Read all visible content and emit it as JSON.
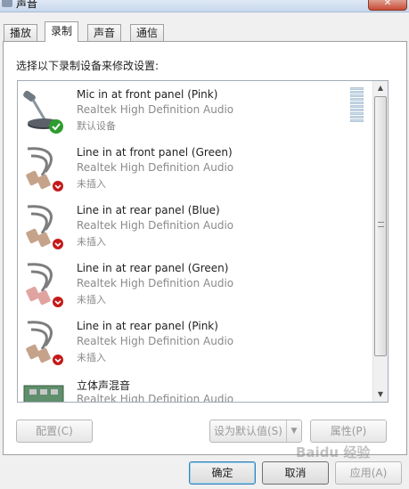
{
  "window": {
    "title": "声音"
  },
  "tabs": [
    {
      "label": "播放",
      "active": false
    },
    {
      "label": "录制",
      "active": true
    },
    {
      "label": "声音",
      "active": false
    },
    {
      "label": "通信",
      "active": false
    }
  ],
  "instruction": "选择以下录制设备来修改设置:",
  "devices": [
    {
      "name": "Mic in at front panel (Pink)",
      "driver": "Realtek High Definition Audio",
      "status": "默认设备",
      "icon": "microphone-icon",
      "badge": "default-check-icon"
    },
    {
      "name": "Line in at front panel (Green)",
      "driver": "Realtek High Definition Audio",
      "status": "未插入",
      "icon": "rca-cable-icon",
      "badge": "unplugged-icon"
    },
    {
      "name": "Line in at rear panel (Blue)",
      "driver": "Realtek High Definition Audio",
      "status": "未插入",
      "icon": "rca-cable-icon",
      "badge": "unplugged-icon"
    },
    {
      "name": "Line in at rear panel (Green)",
      "driver": "Realtek High Definition Audio",
      "status": "未插入",
      "icon": "rca-cable-icon",
      "badge": "unplugged-icon"
    },
    {
      "name": "Line in at rear panel (Pink)",
      "driver": "Realtek High Definition Audio",
      "status": "未插入",
      "icon": "rca-cable-icon",
      "badge": "unplugged-icon"
    },
    {
      "name": "立体声混音",
      "driver": "Realtek High Definition Audio",
      "status": "",
      "icon": "sound-card-icon",
      "badge": ""
    }
  ],
  "buttons": {
    "configure": "配置(C)",
    "set_default": "设为默认值(S)",
    "properties": "属性(P)",
    "ok": "确定",
    "cancel": "取消",
    "apply": "应用(A)"
  },
  "watermark": "Baidu 经验",
  "colors": {
    "accent_check": "#2e9c2e",
    "unplugged_badge": "#c41a1a",
    "list_border": "#a5acb5"
  }
}
